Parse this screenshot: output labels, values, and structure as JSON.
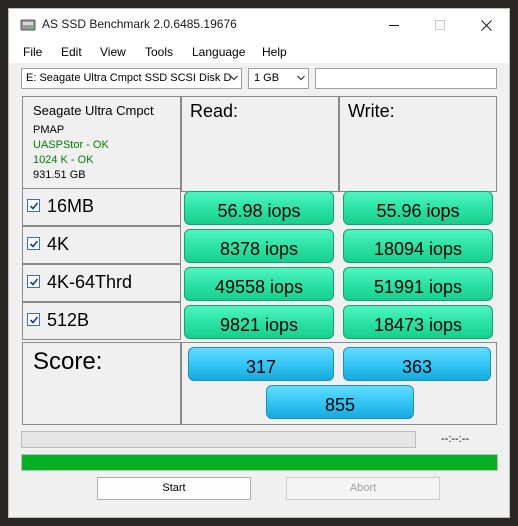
{
  "window": {
    "title": "AS SSD Benchmark 2.0.6485.19676"
  },
  "menu": {
    "items": [
      "File",
      "Edit",
      "View",
      "Tools",
      "Language",
      "Help"
    ]
  },
  "toolbar": {
    "drive": "E: Seagate Ultra Cmpct SSD SCSI Disk D",
    "size": "1 GB",
    "blank": ""
  },
  "info": {
    "name": "Seagate Ultra Cmpct",
    "lines": [
      "PMAP",
      "UASPStor - OK",
      "1024 K - OK",
      "931.51 GB"
    ],
    "status_color": "#008000"
  },
  "headers": {
    "read": "Read:",
    "write": "Write:"
  },
  "tests": [
    {
      "label": "16MB",
      "checked": true,
      "read": "56.98 iops",
      "write": "55.96 iops"
    },
    {
      "label": "4K",
      "checked": true,
      "read": "8378 iops",
      "write": "18094 iops"
    },
    {
      "label": "4K-64Thrd",
      "checked": true,
      "read": "49558 iops",
      "write": "51991 iops"
    },
    {
      "label": "512B",
      "checked": true,
      "read": "9821 iops",
      "write": "18473 iops"
    }
  ],
  "score": {
    "label": "Score:",
    "read": "317",
    "write": "363",
    "total": "855"
  },
  "progress": {
    "elapsed": "--:--:--",
    "top_fraction": 0,
    "bottom_fraction": 1.0
  },
  "buttons": {
    "start": "Start",
    "abort": "Abort"
  },
  "colors": {
    "result_green": "#2ce3a6",
    "score_blue": "#35c6f5",
    "progress_green": "#06b025"
  }
}
